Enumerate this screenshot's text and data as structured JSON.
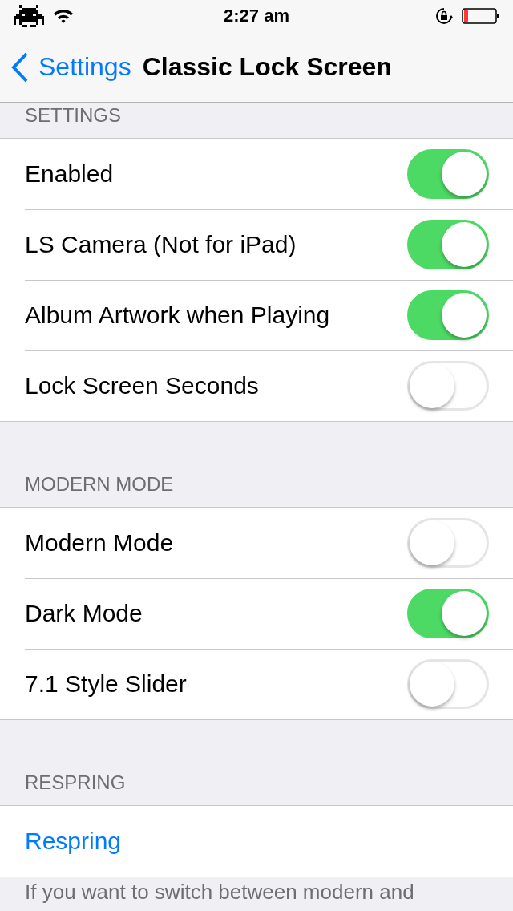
{
  "status_bar": {
    "time": "2:27 am"
  },
  "nav": {
    "back": "Settings",
    "title": "Classic Lock Screen"
  },
  "sections": [
    {
      "header": "SETTINGS",
      "rows": [
        {
          "kind": "toggle",
          "label": "Enabled",
          "on": true
        },
        {
          "kind": "toggle",
          "label": "LS Camera (Not for iPad)",
          "on": true
        },
        {
          "kind": "toggle",
          "label": "Album Artwork when Playing",
          "on": true
        },
        {
          "kind": "toggle",
          "label": "Lock Screen Seconds",
          "on": false
        }
      ]
    },
    {
      "header": "MODERN MODE",
      "rows": [
        {
          "kind": "toggle",
          "label": "Modern Mode",
          "on": false
        },
        {
          "kind": "toggle",
          "label": "Dark Mode",
          "on": true
        },
        {
          "kind": "toggle",
          "label": "7.1 Style Slider",
          "on": false
        }
      ]
    },
    {
      "header": "RESPRING",
      "rows": [
        {
          "kind": "button",
          "label": "Respring"
        }
      ],
      "footer": "If you want to switch between modern and"
    }
  ]
}
